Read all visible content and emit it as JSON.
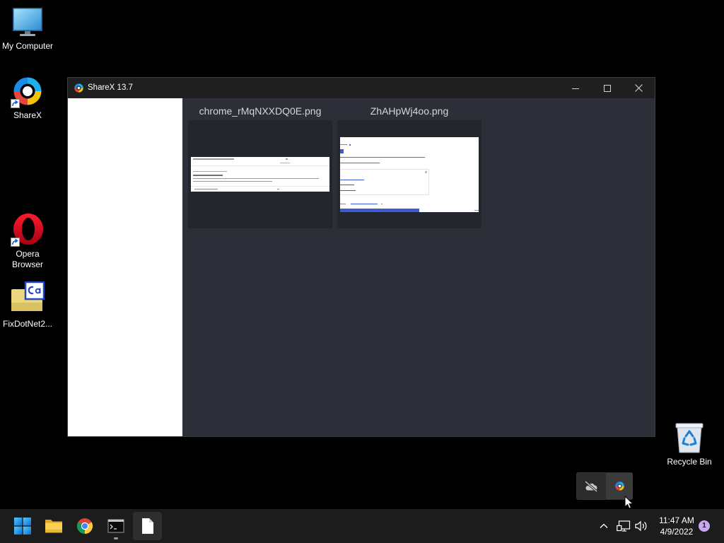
{
  "colors": {
    "desktop_background": "#000000",
    "taskbar": "#1c1c1c",
    "gallery_background": "#2c2f37",
    "thumbnail_tile": "#23262d",
    "notification_badge": "#c9a7f0"
  },
  "desktop": {
    "icons": [
      {
        "label": "My Computer",
        "icon": "my-computer-icon",
        "shortcut": false
      },
      {
        "label": "ShareX",
        "icon": "sharex-icon",
        "shortcut": true
      },
      {
        "label": "Opera Browser",
        "icon": "opera-icon",
        "shortcut": true
      },
      {
        "label": "FixDotNet2...",
        "icon": "cab-file-icon",
        "shortcut": false
      },
      {
        "label": "Recycle Bin",
        "icon": "recycle-bin-icon",
        "shortcut": false
      }
    ]
  },
  "window": {
    "title": "ShareX 13.7",
    "app_icon": "sharex-icon",
    "controls": {
      "minimize": "minimize-icon",
      "maximize": "maximize-icon",
      "close": "close-icon"
    },
    "files": [
      {
        "name": "chrome_rMqNXXDQ0E.png"
      },
      {
        "name": "ZhAHpWj4oo.png"
      }
    ]
  },
  "tray_overflow": {
    "icons": [
      "cloud-off-icon",
      "sharex-icon"
    ]
  },
  "taskbar": {
    "pinned": [
      {
        "icon": "start-icon"
      },
      {
        "icon": "file-explorer-icon"
      },
      {
        "icon": "chrome-icon"
      },
      {
        "icon": "command-prompt-icon",
        "running": true
      },
      {
        "icon": "document-icon",
        "active": true
      }
    ],
    "tray": {
      "icons": [
        "chevron-up-icon",
        "network-icon",
        "volume-icon"
      ]
    },
    "clock": {
      "time": "11:47 AM",
      "date": "4/9/2022"
    },
    "notification_count": "1"
  }
}
